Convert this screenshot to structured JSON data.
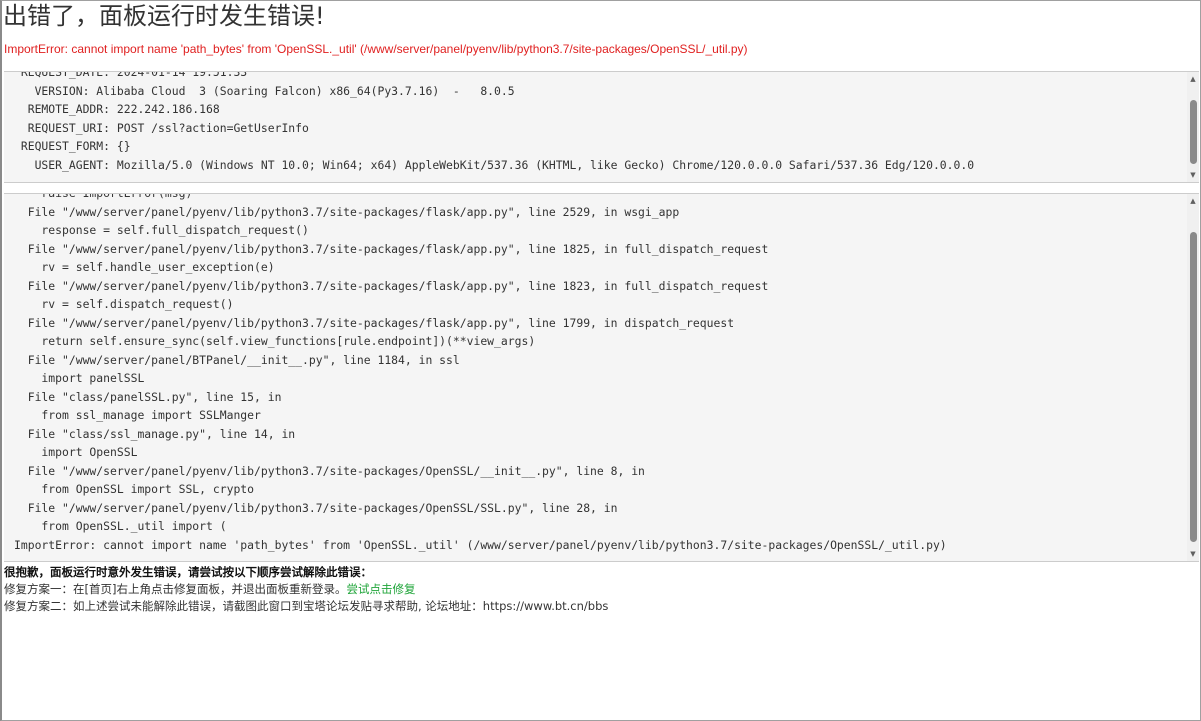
{
  "title": "出错了，面板运行时发生错误!",
  "error_message": "ImportError: cannot import name 'path_bytes' from 'OpenSSL._util' (/www/server/panel/pyenv/lib/python3.7/site-packages/OpenSSL/_util.py)",
  "env_panel": {
    "lines": [
      " REQUEST_DATE: 2024-01-14 19:51:33",
      "   VERSION: Alibaba Cloud  3 (Soaring Falcon) x86_64(Py3.7.16)  -   8.0.5",
      "  REMOTE_ADDR: 222.242.186.168",
      "  REQUEST_URI: POST /ssl?action=GetUserInfo",
      " REQUEST_FORM: {}",
      "   USER_AGENT: Mozilla/5.0 (Windows NT 10.0; Win64; x64) AppleWebKit/537.36 (KHTML, like Gecko) Chrome/120.0.0.0 Safari/537.36 Edg/120.0.0.0"
    ]
  },
  "trace_panel": {
    "lines": [
      "    raise ImportError(msg)",
      "  File \"/www/server/panel/pyenv/lib/python3.7/site-packages/flask/app.py\", line 2529, in wsgi_app",
      "    response = self.full_dispatch_request()",
      "  File \"/www/server/panel/pyenv/lib/python3.7/site-packages/flask/app.py\", line 1825, in full_dispatch_request",
      "    rv = self.handle_user_exception(e)",
      "  File \"/www/server/panel/pyenv/lib/python3.7/site-packages/flask/app.py\", line 1823, in full_dispatch_request",
      "    rv = self.dispatch_request()",
      "  File \"/www/server/panel/pyenv/lib/python3.7/site-packages/flask/app.py\", line 1799, in dispatch_request",
      "    return self.ensure_sync(self.view_functions[rule.endpoint])(**view_args)",
      "  File \"/www/server/panel/BTPanel/__init__.py\", line 1184, in ssl",
      "    import panelSSL",
      "  File \"class/panelSSL.py\", line 15, in",
      "    from ssl_manage import SSLManger",
      "  File \"class/ssl_manage.py\", line 14, in",
      "    import OpenSSL",
      "  File \"/www/server/panel/pyenv/lib/python3.7/site-packages/OpenSSL/__init__.py\", line 8, in",
      "    from OpenSSL import SSL, crypto",
      "  File \"/www/server/panel/pyenv/lib/python3.7/site-packages/OpenSSL/SSL.py\", line 28, in",
      "    from OpenSSL._util import (",
      "ImportError: cannot import name 'path_bytes' from 'OpenSSL._util' (/www/server/panel/pyenv/lib/python3.7/site-packages/OpenSSL/_util.py)"
    ]
  },
  "help": {
    "heading": "很抱歉，面板运行时意外发生错误，请尝试按以下顺序尝试解除此错误：",
    "option1_text": "修复方案一：在[首页]右上角点击修复面板，并退出面板重新登录。",
    "option1_link": "尝试点击修复",
    "option2_text": "修复方案二：如上述尝试未能解除此错误，请截图此窗口到宝塔论坛发贴寻求帮助, 论坛地址：https://www.bt.cn/bbs"
  },
  "icons": {
    "scroll_up": "▲",
    "scroll_down": "▼"
  },
  "colors": {
    "error_red": "#e02020",
    "link_green": "#20a53a",
    "panel_bg": "#f5f5f5"
  }
}
